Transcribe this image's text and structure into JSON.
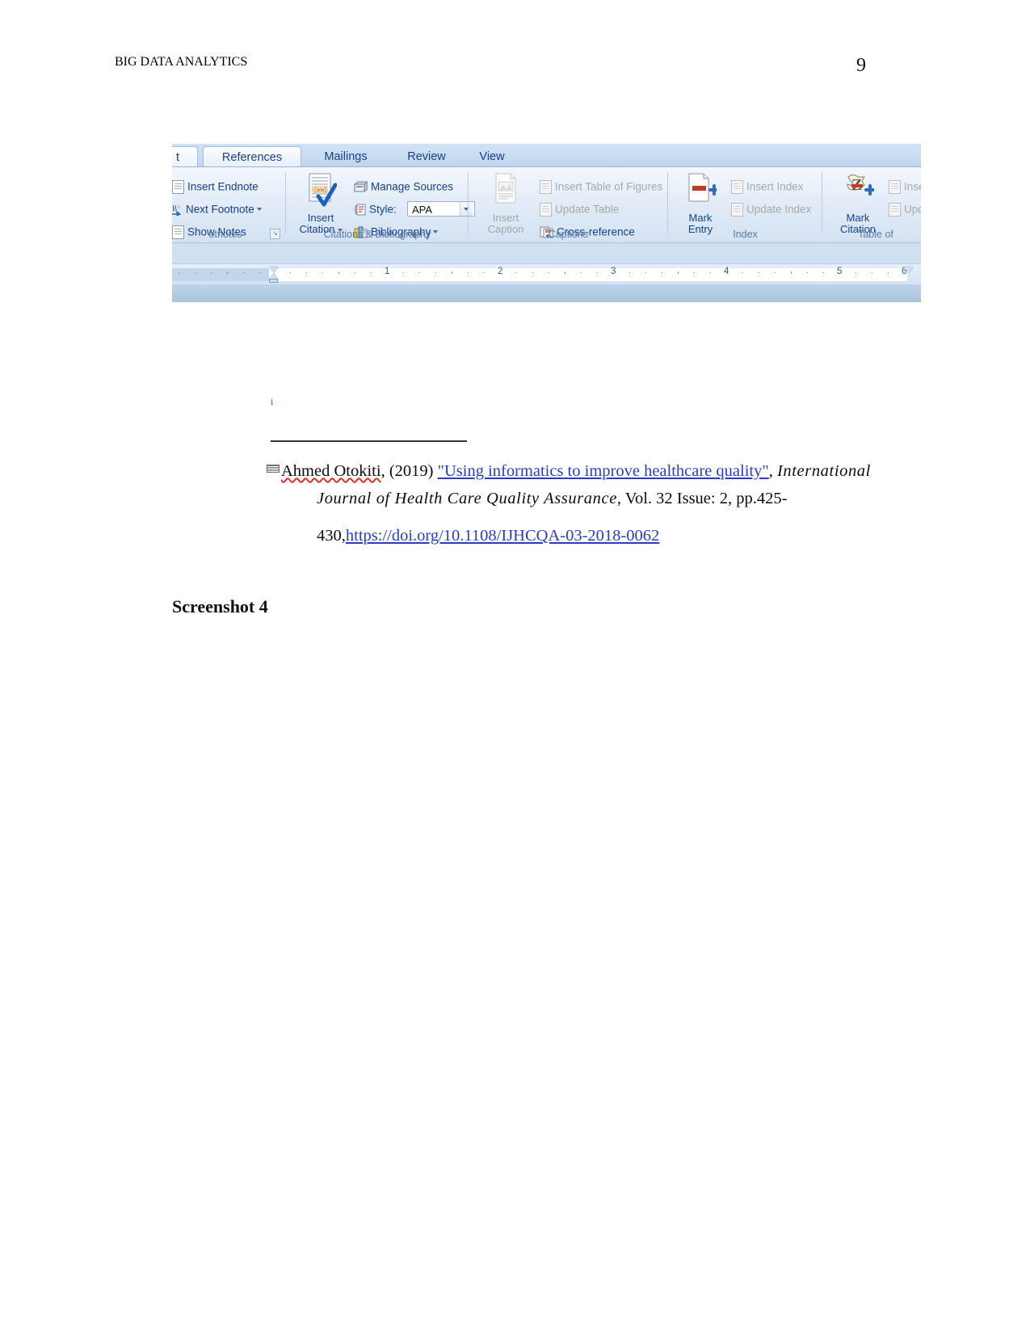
{
  "document": {
    "running_head": "BIG DATA ANALYTICS",
    "page_number": "9",
    "figure_caption": "Screenshot 4"
  },
  "word_screenshot": {
    "tabs": [
      {
        "label": "t",
        "active": false,
        "clipped": true
      },
      {
        "label": "References",
        "active": true
      },
      {
        "label": "Mailings",
        "active": false
      },
      {
        "label": "Review",
        "active": false
      },
      {
        "label": "View",
        "active": false
      }
    ],
    "groups": [
      {
        "name": "footnotes",
        "label": "otnotes",
        "items": [
          {
            "label": "Insert Endnote",
            "icon": "insert-endnote-icon",
            "disabled": false
          },
          {
            "label": "Next Footnote",
            "icon": "next-footnote-icon",
            "disabled": false,
            "has_caret": true
          },
          {
            "label": "Show Notes",
            "icon": "show-notes-icon",
            "disabled": false
          }
        ],
        "dialog_launcher": "↘"
      },
      {
        "name": "citations-bibliography",
        "label": "Citations & Bibliography",
        "big_button": {
          "line1": "Insert",
          "line2": "Citation",
          "icon": "insert-citation-icon",
          "has_caret": true
        },
        "items": [
          {
            "label": "Manage Sources",
            "icon": "manage-sources-icon",
            "disabled": false
          },
          {
            "label": "Style:",
            "icon": "style-icon",
            "disabled": false,
            "value": "APA"
          },
          {
            "label": "Bibliography",
            "icon": "bibliography-icon",
            "disabled": false,
            "has_caret": true
          }
        ]
      },
      {
        "name": "captions",
        "label": "Captions",
        "big_button": {
          "line1": "Insert",
          "line2": "Caption",
          "icon": "insert-caption-icon",
          "disabled": true
        },
        "items": [
          {
            "label": "Insert Table of Figures",
            "icon": "insert-table-of-figures-icon",
            "disabled": true
          },
          {
            "label": "Update Table",
            "icon": "update-table-icon",
            "disabled": true
          },
          {
            "label": "Cross-reference",
            "icon": "cross-reference-icon",
            "disabled": false
          }
        ]
      },
      {
        "name": "index",
        "label": "Index",
        "big_button": {
          "line1": "Mark",
          "line2": "Entry",
          "icon": "mark-entry-icon",
          "disabled": false
        },
        "items": [
          {
            "label": "Insert Index",
            "icon": "insert-index-icon",
            "disabled": true
          },
          {
            "label": "Update Index",
            "icon": "update-index-icon",
            "disabled": true
          }
        ]
      },
      {
        "name": "table-of-authorities",
        "label": "Table of",
        "big_button": {
          "line1": "Mark",
          "line2": "Citation",
          "icon": "mark-citation-icon",
          "disabled": false
        },
        "items": [
          {
            "label": "Insert",
            "icon": "insert-table-of-authorities-icon",
            "disabled": true
          },
          {
            "label": "Upda",
            "icon": "update-table-of-authorities-icon",
            "disabled": true
          }
        ]
      }
    ],
    "ruler": {
      "numbers": [
        "1",
        "2",
        "3",
        "4",
        "5",
        "6"
      ],
      "units": "inches"
    },
    "style_value": "APA"
  },
  "footnote": {
    "reference_mark": "i",
    "citation": {
      "author": "Ahmed Otokiti",
      "year": ", (2019) ",
      "title": "\"Using  informatics  to improve  healthcare  quality\"",
      "title_trailing": ", ",
      "journal": "International",
      "line2_journal": "Journal of Health Care Quality Assurance",
      "line2_rest": ",  Vol. 32 Issue:  2, pp.425-",
      "line3_prefix": "430,",
      "line3_url": "https://doi.org/10.1108/IJHCQA-03-2018-0062"
    }
  }
}
